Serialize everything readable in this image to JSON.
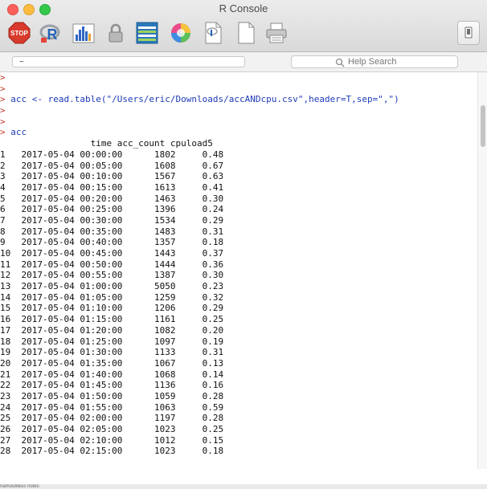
{
  "window": {
    "title": "R Console"
  },
  "toolbar": {
    "stop": "STOP",
    "rlogo": "R"
  },
  "path": {
    "value": "~"
  },
  "search": {
    "placeholder": "Help Search"
  },
  "console": {
    "lines": [
      {
        "type": "prompt",
        "text": ">"
      },
      {
        "type": "prompt",
        "text": ">"
      },
      {
        "type": "cmd",
        "text": "> acc <- read.table(\"/Users/eric/Downloads/accANDcpu.csv\",header=T,sep=\",\")"
      },
      {
        "type": "prompt",
        "text": ">"
      },
      {
        "type": "prompt",
        "text": ">"
      },
      {
        "type": "cmd",
        "text": "> acc"
      },
      {
        "type": "out",
        "text": "                 time acc_count cpuload5"
      },
      {
        "type": "out",
        "text": "1   2017-05-04 00:00:00      1802     0.48"
      },
      {
        "type": "out",
        "text": "2   2017-05-04 00:05:00      1608     0.67"
      },
      {
        "type": "out",
        "text": "3   2017-05-04 00:10:00      1567     0.63"
      },
      {
        "type": "out",
        "text": "4   2017-05-04 00:15:00      1613     0.41"
      },
      {
        "type": "out",
        "text": "5   2017-05-04 00:20:00      1463     0.30"
      },
      {
        "type": "out",
        "text": "6   2017-05-04 00:25:00      1396     0.24"
      },
      {
        "type": "out",
        "text": "7   2017-05-04 00:30:00      1534     0.29"
      },
      {
        "type": "out",
        "text": "8   2017-05-04 00:35:00      1483     0.31"
      },
      {
        "type": "out",
        "text": "9   2017-05-04 00:40:00      1357     0.18"
      },
      {
        "type": "out",
        "text": "10  2017-05-04 00:45:00      1443     0.37"
      },
      {
        "type": "out",
        "text": "11  2017-05-04 00:50:00      1444     0.36"
      },
      {
        "type": "out",
        "text": "12  2017-05-04 00:55:00      1387     0.30"
      },
      {
        "type": "out",
        "text": "13  2017-05-04 01:00:00      5050     0.23"
      },
      {
        "type": "out",
        "text": "14  2017-05-04 01:05:00      1259     0.32"
      },
      {
        "type": "out",
        "text": "15  2017-05-04 01:10:00      1206     0.29"
      },
      {
        "type": "out",
        "text": "16  2017-05-04 01:15:00      1161     0.25"
      },
      {
        "type": "out",
        "text": "17  2017-05-04 01:20:00      1082     0.20"
      },
      {
        "type": "out",
        "text": "18  2017-05-04 01:25:00      1097     0.19"
      },
      {
        "type": "out",
        "text": "19  2017-05-04 01:30:00      1133     0.31"
      },
      {
        "type": "out",
        "text": "20  2017-05-04 01:35:00      1067     0.13"
      },
      {
        "type": "out",
        "text": "21  2017-05-04 01:40:00      1068     0.14"
      },
      {
        "type": "out",
        "text": "22  2017-05-04 01:45:00      1136     0.16"
      },
      {
        "type": "out",
        "text": "23  2017-05-04 01:50:00      1059     0.28"
      },
      {
        "type": "out",
        "text": "24  2017-05-04 01:55:00      1063     0.59"
      },
      {
        "type": "out",
        "text": "25  2017-05-04 02:00:00      1197     0.28"
      },
      {
        "type": "out",
        "text": "26  2017-05-04 02:05:00      1023     0.25"
      },
      {
        "type": "out",
        "text": "27  2017-05-04 02:10:00      1012     0.15"
      },
      {
        "type": "out",
        "text": "28  2017-05-04 02:15:00      1023     0.18"
      }
    ]
  },
  "footer": {
    "text": "namoutileus notes"
  },
  "colors": {
    "prompt": "#c0392b",
    "command": "#1d3bb9",
    "output": "#111111"
  }
}
